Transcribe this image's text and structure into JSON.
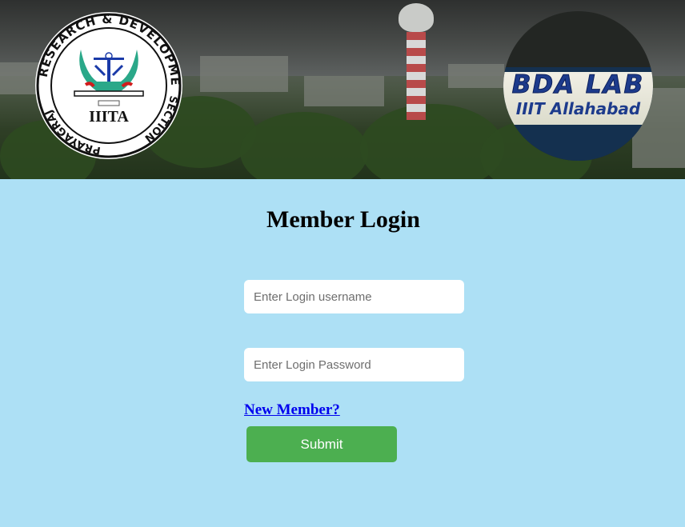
{
  "header": {
    "left_logo": {
      "ring_text_top": "RESEARCH & DEVELOPMENT",
      "ring_text_right": "SECTION",
      "ring_text_bottom": "PRAYAGRAJ",
      "center_text": "IIITA"
    },
    "right_logo": {
      "line1": "BDA LAB",
      "line2": "IIIT Allahabad"
    }
  },
  "login": {
    "title": "Member Login",
    "username_placeholder": "Enter Login username",
    "password_placeholder": "Enter Login Password",
    "new_member_link": "New Member?",
    "submit_label": "Submit"
  },
  "colors": {
    "page_background": "#ade0f5",
    "submit_button": "#4caf50",
    "link": "#0000ee"
  }
}
